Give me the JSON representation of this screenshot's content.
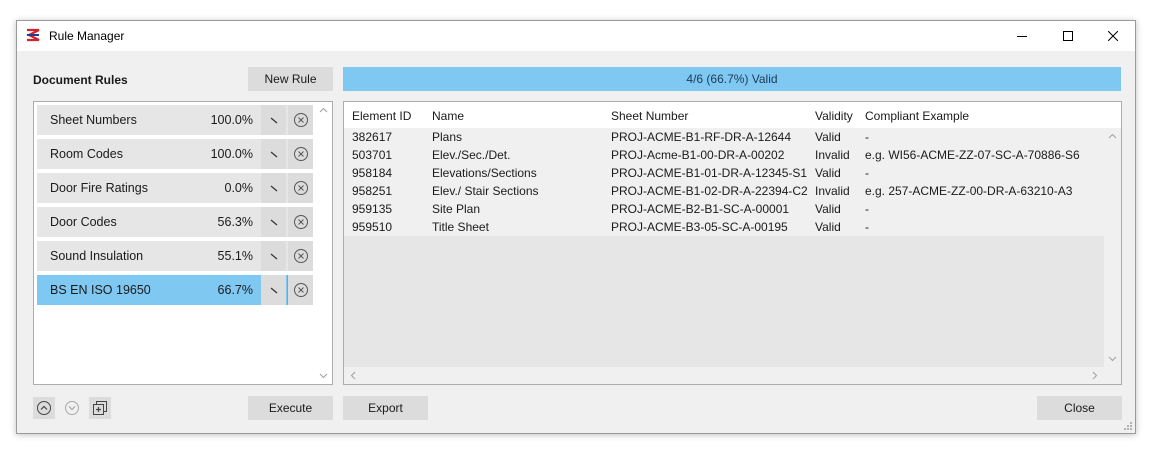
{
  "window": {
    "title": "Rule Manager",
    "icon": "rule-manager-logo-icon",
    "controls": [
      "minimize-icon",
      "maximize-icon",
      "close-icon"
    ]
  },
  "rules_panel": {
    "title": "Document Rules",
    "new_rule_label": "New Rule",
    "execute_label": "Execute",
    "rules": [
      {
        "name": "Sheet Numbers",
        "percent": "100.0%",
        "selected": false
      },
      {
        "name": "Room Codes",
        "percent": "100.0%",
        "selected": false
      },
      {
        "name": "Door Fire Ratings",
        "percent": "0.0%",
        "selected": false
      },
      {
        "name": "Door Codes",
        "percent": "56.3%",
        "selected": false
      },
      {
        "name": "Sound Insulation",
        "percent": "55.1%",
        "selected": false
      },
      {
        "name": "BS EN ISO 19650",
        "percent": "66.7%",
        "selected": true
      }
    ]
  },
  "progress": {
    "label": "4/6 (66.7%) Valid",
    "fraction": 1.0
  },
  "results": {
    "columns": [
      "Element ID",
      "Name",
      "Sheet Number",
      "Validity",
      "Compliant Example"
    ],
    "rows": [
      [
        "382617",
        "Plans",
        "PROJ-ACME-B1-RF-DR-A-12644",
        "Valid",
        "-"
      ],
      [
        "503701",
        "Elev./Sec./Det.",
        "PROJ-Acme-B1-00-DR-A-00202",
        "Invalid",
        "e.g. WI56-ACME-ZZ-07-SC-A-70886-S6"
      ],
      [
        "958184",
        "Elevations/Sections",
        "PROJ-ACME-B1-01-DR-A-12345-S1",
        "Valid",
        "-"
      ],
      [
        "958251",
        "Elev./ Stair Sections",
        "PROJ-ACME-B1-02-DR-A-22394-C2",
        "Invalid",
        "e.g. 257-ACME-ZZ-00-DR-A-63210-A3"
      ],
      [
        "959135",
        "Site Plan",
        "PROJ-ACME-B2-B1-SC-A-00001",
        "Valid",
        "-"
      ],
      [
        "959510",
        "Title Sheet",
        "PROJ-ACME-B3-05-SC-A-00195",
        "Valid",
        "-"
      ]
    ]
  },
  "footer": {
    "export_label": "Export",
    "close_label": "Close"
  },
  "colors": {
    "accent": "#7ec8f2",
    "button": "#dcdcdc",
    "row": "#e6e6e6"
  }
}
